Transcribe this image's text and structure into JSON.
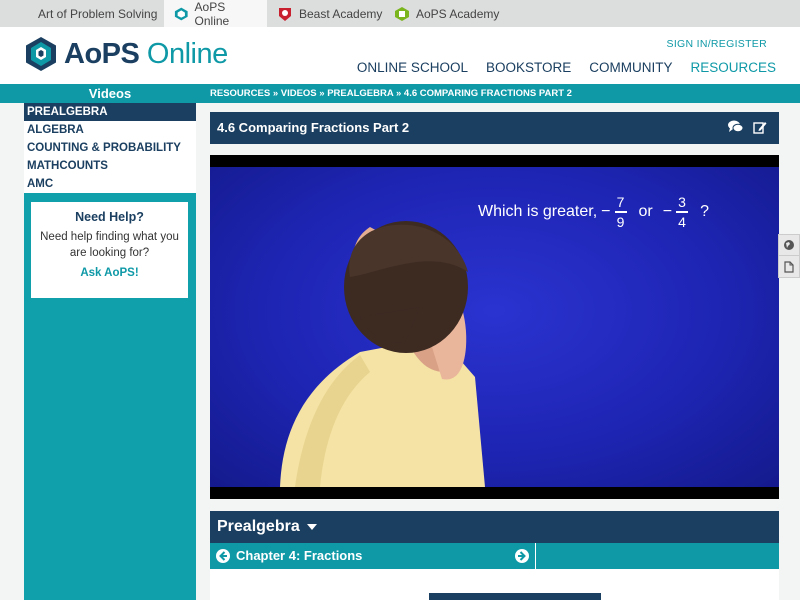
{
  "sitebar": {
    "sites": [
      {
        "label": "Art of Problem Solving"
      },
      {
        "label": "AoPS Online"
      },
      {
        "label": "Beast Academy"
      },
      {
        "label": "AoPS Academy"
      }
    ]
  },
  "header": {
    "logo_bold": "AoPS",
    "logo_light": "Online",
    "signin": "SIGN IN/REGISTER",
    "nav": [
      "ONLINE SCHOOL",
      "BOOKSTORE",
      "COMMUNITY",
      "RESOURCES"
    ]
  },
  "strip": {
    "title": "Videos",
    "breadcrumb": "RESOURCES » VIDEOS » PREALGEBRA » 4.6 COMPARING FRACTIONS PART 2"
  },
  "sidebar": {
    "items": [
      "PREALGEBRA",
      "ALGEBRA",
      "COUNTING & PROBABILITY",
      "MATHCOUNTS",
      "AMC"
    ],
    "help": {
      "title": "Need Help?",
      "text": "Need help finding what you are looking for?",
      "link": "Ask AoPS!"
    }
  },
  "video": {
    "title": "4.6 Comparing Fractions Part 2",
    "question_prefix": "Which is greater,",
    "frac1_num": "7",
    "frac1_den": "9",
    "or_word": "or",
    "frac2_num": "3",
    "frac2_den": "4",
    "question_suffix": "?"
  },
  "course": {
    "heading": "Prealgebra",
    "chapter": "Chapter 4: Fractions"
  },
  "colors": {
    "navy": "#1b3f60",
    "teal": "#0f99a7",
    "video_blue": "#1e25b4"
  }
}
